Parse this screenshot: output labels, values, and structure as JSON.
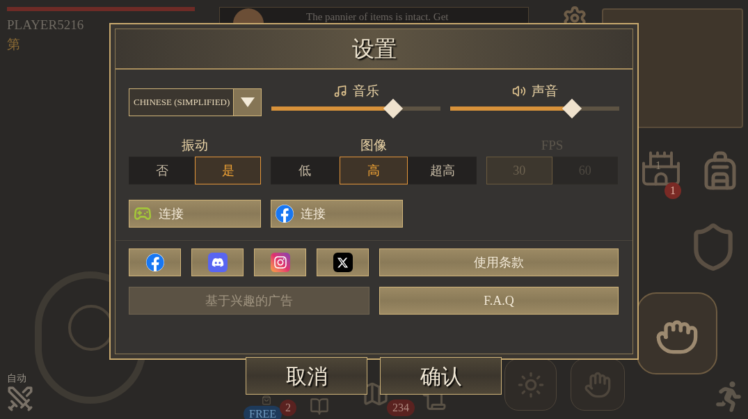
{
  "hud": {
    "player_name": "PLAYER5216",
    "level_label": "第",
    "message": "The pannier of items is intact. Get",
    "auto_label": "自动",
    "castle_level": "1",
    "badges": [
      {
        "kind": "alert",
        "text": "1"
      },
      {
        "kind": "free",
        "text": "FREE"
      },
      {
        "kind": "count",
        "text": "2"
      },
      {
        "kind": "count",
        "text": "234"
      }
    ]
  },
  "dialog": {
    "title": "设置",
    "language": {
      "value": "CHINESE (SIMPLIFIED)"
    },
    "sliders": [
      {
        "kind": "music",
        "label": "音乐",
        "level": 0.72
      },
      {
        "kind": "sound",
        "label": "声音",
        "level": 0.72
      }
    ],
    "toggles": [
      {
        "label": "振动",
        "disabled": false,
        "options": [
          {
            "label": "否",
            "selected": false
          },
          {
            "label": "是",
            "selected": true
          }
        ]
      },
      {
        "label": "图像",
        "disabled": false,
        "options": [
          {
            "label": "低",
            "selected": false
          },
          {
            "label": "高",
            "selected": true
          },
          {
            "label": "超高",
            "selected": false
          }
        ]
      },
      {
        "label": "FPS",
        "disabled": true,
        "options": [
          {
            "label": "30",
            "selected": true
          },
          {
            "label": "60",
            "selected": false
          }
        ]
      }
    ],
    "connect": [
      {
        "kind": "gamepad",
        "label": "连接"
      },
      {
        "kind": "facebook",
        "label": "连接"
      }
    ],
    "socials": [
      {
        "kind": "facebook"
      },
      {
        "kind": "discord"
      },
      {
        "kind": "instagram"
      },
      {
        "kind": "x"
      }
    ],
    "links": [
      {
        "label": "使用条款",
        "disabled": false
      },
      {
        "label": "基于兴趣的广告",
        "disabled": true
      },
      {
        "label": "F.A.Q",
        "disabled": false
      }
    ],
    "buttons": [
      {
        "label": "取消"
      },
      {
        "label": "确认"
      }
    ]
  }
}
